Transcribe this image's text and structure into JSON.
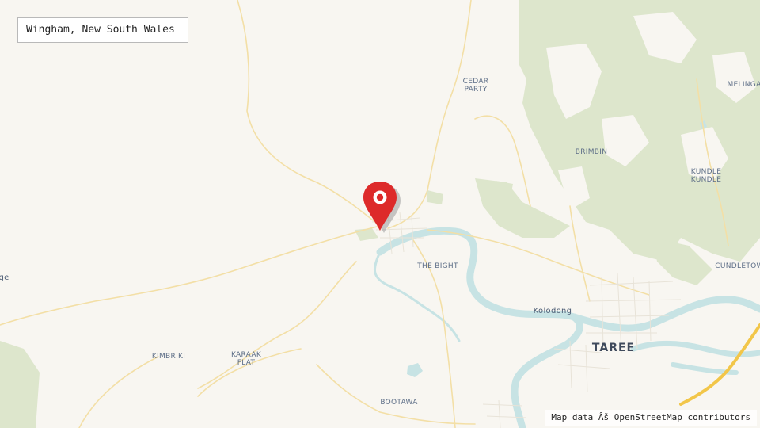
{
  "title": "Wingham, New South Wales",
  "attribution": "Map data Âš OpenStreetMap contributors",
  "colors": {
    "land": "#f8f6f1",
    "forest": "#dde6cc",
    "water": "#c7e3e4",
    "road": "#f3dfa6",
    "highway": "#f2c649",
    "marker": "#dd2a2a"
  },
  "places": {
    "cedar_party": "CEDAR\nPARTY",
    "melinga": "MELINGA",
    "brimbin": "BRIMBIN",
    "kundle_kundle": "KUNDLE\nKUNDLE",
    "cundletown": "CUNDLETOW",
    "the_bight": "THE BIGHT",
    "kolodong": "Kolodong",
    "taree": "TAREE",
    "kimbriki": "KIMBRIKI",
    "karaak_flat": "KARAAK\nFLAT",
    "bootawa": "BOOTAWA",
    "edge_left": "ge"
  },
  "marker": {
    "icon": "map-pin-icon",
    "label": "Wingham"
  }
}
